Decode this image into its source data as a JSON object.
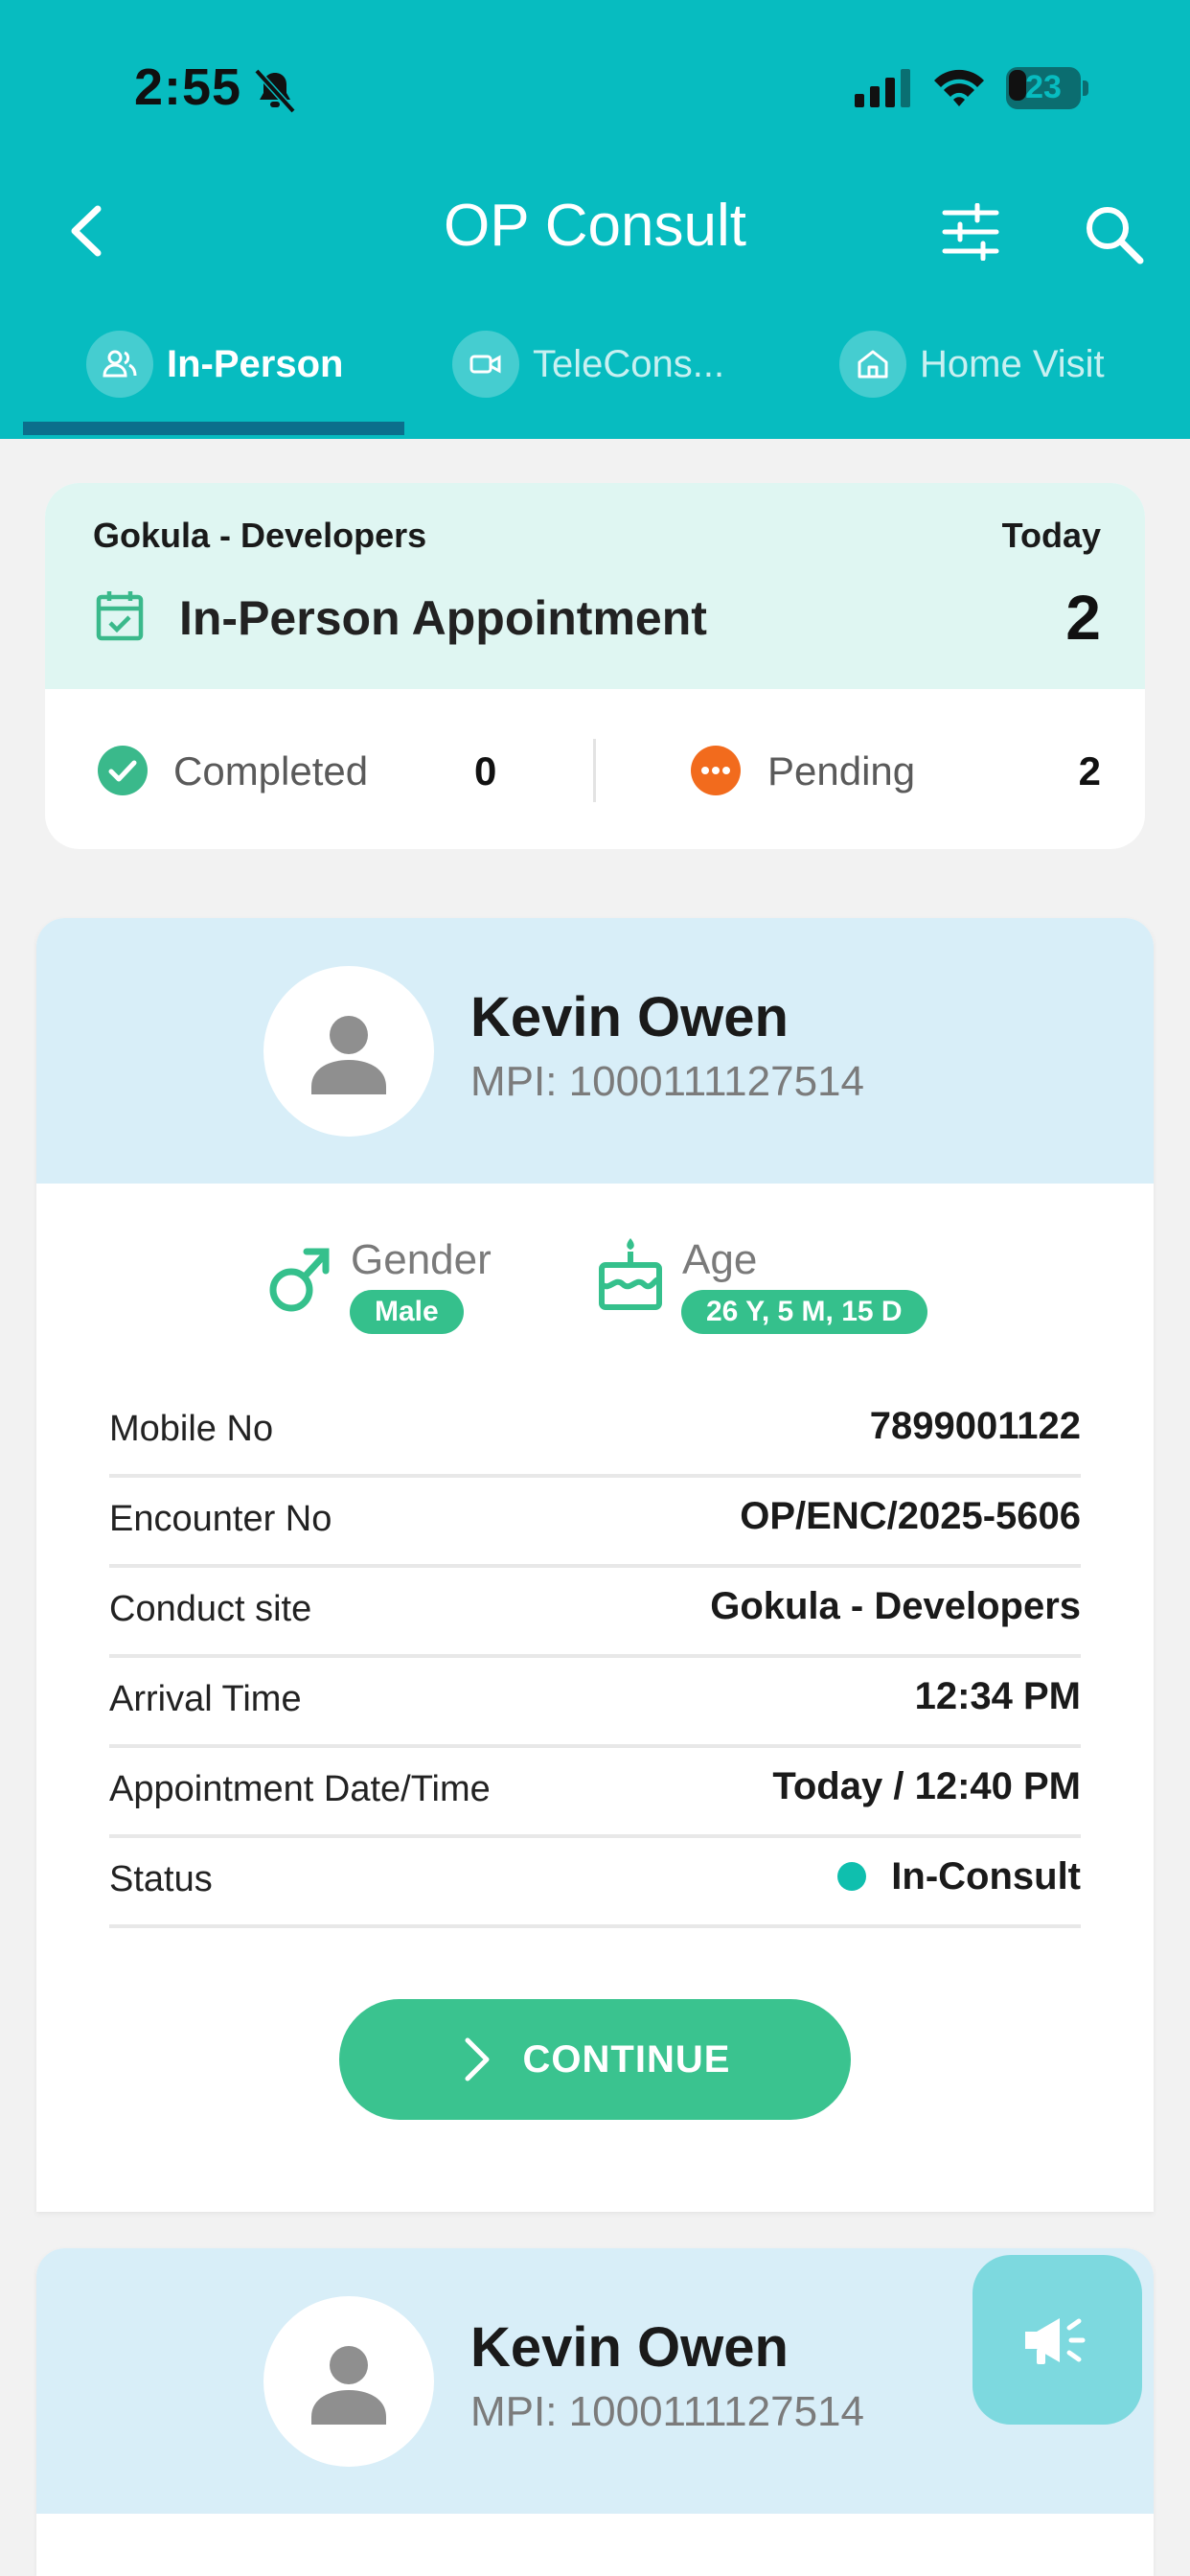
{
  "status_bar": {
    "time": "2:55",
    "battery": "23"
  },
  "header": {
    "title": "OP Consult"
  },
  "tabs": [
    {
      "label": "In-Person",
      "active": true,
      "icon": "people-icon"
    },
    {
      "label": "TeleCons...",
      "active": false,
      "icon": "video-icon"
    },
    {
      "label": "Home Visit",
      "active": false,
      "icon": "home-icon"
    }
  ],
  "summary": {
    "site": "Gokula - Developers",
    "date": "Today",
    "appointment_label": "In-Person Appointment",
    "appointment_count": "2",
    "completed_label": "Completed",
    "completed_count": "0",
    "pending_label": "Pending",
    "pending_count": "2"
  },
  "patients": [
    {
      "name": "Kevin Owen",
      "mpi": "MPI: 1000111127514",
      "gender_label": "Gender",
      "gender": "Male",
      "age_label": "Age",
      "age": "26 Y, 5 M, 15 D",
      "rows": [
        {
          "key": "Mobile No",
          "value": "7899001122"
        },
        {
          "key": "Encounter No",
          "value": "OP/ENC/2025-5606"
        },
        {
          "key": "Conduct site",
          "value": "Gokula - Developers"
        },
        {
          "key": "Arrival Time",
          "value": "12:34 PM"
        },
        {
          "key": "Appointment Date/Time",
          "value": "Today / 12:40 PM"
        },
        {
          "key": "Status",
          "value": "In-Consult"
        }
      ],
      "action_label": "CONTINUE"
    },
    {
      "name": "Kevin Owen",
      "mpi": "MPI: 1000111127514"
    }
  ],
  "colors": {
    "header": "#07bcc0",
    "accent_green": "#3ac38f",
    "pending_orange": "#f26b1d",
    "status_teal": "#0fbfae"
  }
}
